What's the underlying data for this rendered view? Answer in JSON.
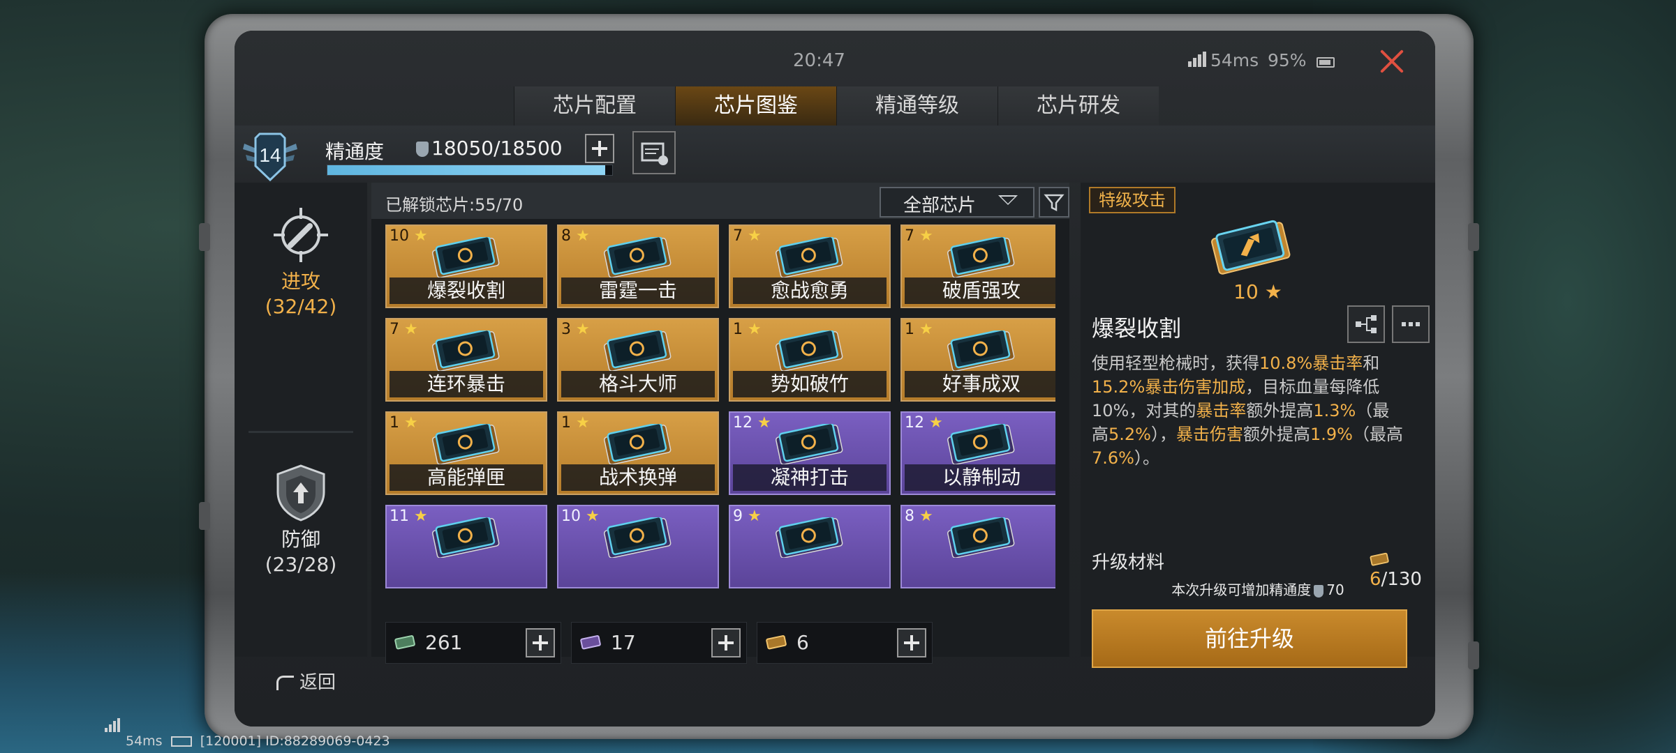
{
  "status": {
    "time": "20:47",
    "ping": "54ms",
    "battery": "95%"
  },
  "tabs": [
    {
      "label": "芯片配置",
      "active": false
    },
    {
      "label": "芯片图鉴",
      "active": true
    },
    {
      "label": "精通等级",
      "active": false
    },
    {
      "label": "芯片研发",
      "active": false
    }
  ],
  "mastery": {
    "level": "14",
    "label": "精通度",
    "value": "18050/18500",
    "progress": 0.976
  },
  "leftnav": [
    {
      "label": "进攻",
      "count": "(32/42)",
      "icon": "crosshair-icon",
      "active": true
    },
    {
      "label": "防御",
      "count": "(23/28)",
      "icon": "shield-icon",
      "active": false
    }
  ],
  "grid": {
    "unlocked_text": "已解锁芯片:55/70",
    "filter_label": "全部芯片",
    "cards": [
      {
        "stars": "10",
        "name": "爆裂收割",
        "color": "gold"
      },
      {
        "stars": "8",
        "name": "雷霆一击",
        "color": "gold"
      },
      {
        "stars": "7",
        "name": "愈战愈勇",
        "color": "gold"
      },
      {
        "stars": "7",
        "name": "破盾强攻",
        "color": "gold"
      },
      {
        "stars": "7",
        "name": "连环暴击",
        "color": "gold"
      },
      {
        "stars": "3",
        "name": "格斗大师",
        "color": "gold"
      },
      {
        "stars": "1",
        "name": "势如破竹",
        "color": "gold"
      },
      {
        "stars": "1",
        "name": "好事成双",
        "color": "gold"
      },
      {
        "stars": "1",
        "name": "高能弹匣",
        "color": "gold"
      },
      {
        "stars": "1",
        "name": "战术换弹",
        "color": "gold"
      },
      {
        "stars": "12",
        "name": "凝神打击",
        "color": "purple"
      },
      {
        "stars": "12",
        "name": "以静制动",
        "color": "purple"
      },
      {
        "stars": "11",
        "name": "",
        "color": "purple"
      },
      {
        "stars": "10",
        "name": "",
        "color": "purple"
      },
      {
        "stars": "9",
        "name": "",
        "color": "purple"
      },
      {
        "stars": "8",
        "name": "",
        "color": "purple"
      }
    ],
    "resources": [
      {
        "value": "261",
        "icon": "green-chip-icon"
      },
      {
        "value": "17",
        "icon": "purple-chip-icon"
      },
      {
        "value": "6",
        "icon": "gold-chip-icon"
      }
    ]
  },
  "detail": {
    "category": "特级攻击",
    "stars": "10",
    "name": "爆裂收割",
    "desc": [
      {
        "t": "使用轻型枪械时，获得",
        "hl": false
      },
      {
        "t": "10.8%暴击率",
        "hl": true
      },
      {
        "t": "和",
        "hl": false
      },
      {
        "t": "15.2%暴击伤害加成",
        "hl": true
      },
      {
        "t": "，目标血量每降低10%，对其的",
        "hl": false
      },
      {
        "t": "暴击率",
        "hl": true
      },
      {
        "t": "额外提高",
        "hl": false
      },
      {
        "t": "1.3%",
        "hl": true
      },
      {
        "t": "（最高",
        "hl": false
      },
      {
        "t": "5.2%",
        "hl": true
      },
      {
        "t": "），",
        "hl": false
      },
      {
        "t": "暴击伤害",
        "hl": true
      },
      {
        "t": "额外提高",
        "hl": false
      },
      {
        "t": "1.9%",
        "hl": true
      },
      {
        "t": "（最高",
        "hl": false
      },
      {
        "t": "7.6%",
        "hl": true
      },
      {
        "t": "）。",
        "hl": false
      }
    ],
    "upgrade_label": "升级材料",
    "upgrade_current": "6",
    "upgrade_total": "/130",
    "upgrade_note_a": "本次升级可增加精通度",
    "upgrade_note_b": "70",
    "go_button": "前往升级"
  },
  "back_label": "返回",
  "footer": {
    "ping": "54ms",
    "build": "[120001] ID:88289069-0423"
  },
  "colors": {
    "accent": "#e39a2a",
    "gold_card": "#c98f38",
    "purple_card": "#6a51ae",
    "close": "#e05040"
  }
}
